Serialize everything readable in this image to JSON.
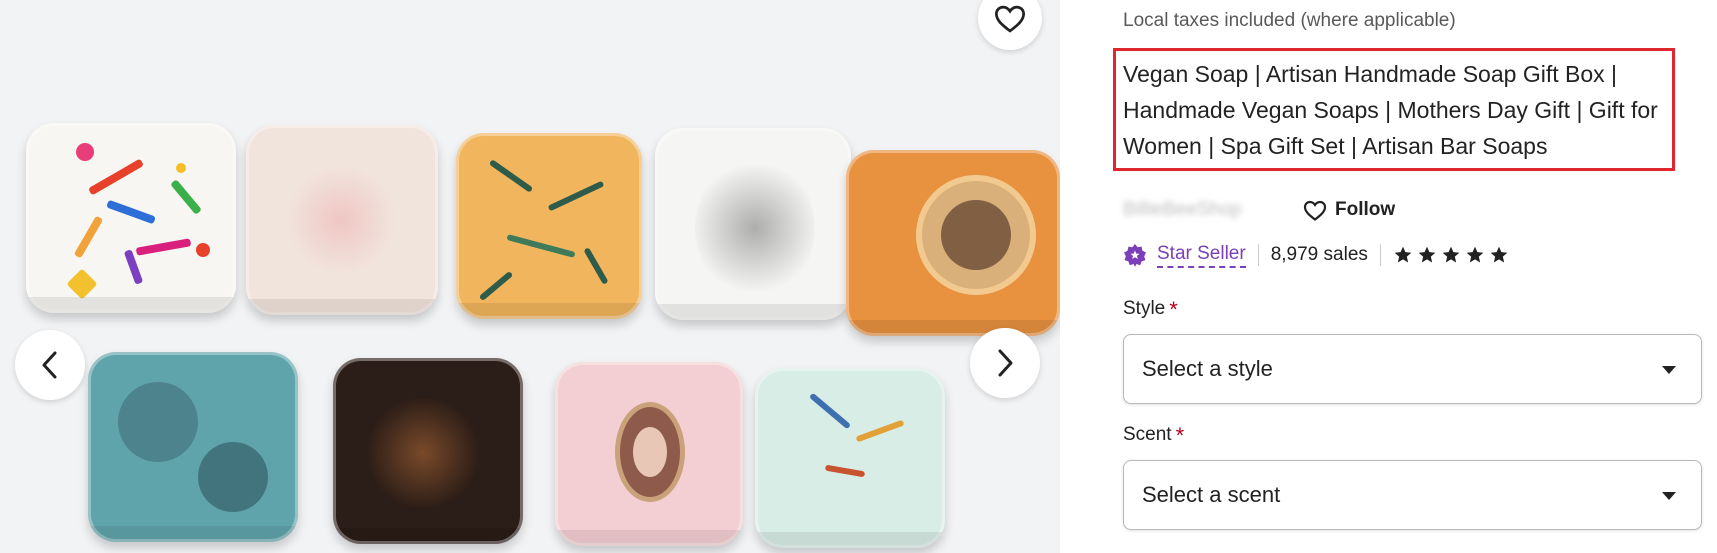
{
  "image": {
    "favorite_icon": "heart-outline-icon",
    "prev_icon": "chevron-left-icon",
    "next_icon": "chevron-right-icon"
  },
  "listing": {
    "tax_note": "Local taxes included (where applicable)",
    "title": "Vegan Soap | Artisan Handmade Soap Gift Box | Handmade Vegan Soaps | Mothers Day Gift | Gift for Women | Spa Gift Set | Artisan Bar Soaps"
  },
  "shop": {
    "name": "BillieBeeShop",
    "follow_label": "Follow",
    "star_seller_label": "Star Seller",
    "sales": "8,979 sales",
    "rating_stars": 5
  },
  "options": {
    "style_label": "Style",
    "style_placeholder": "Select a style",
    "scent_label": "Scent",
    "scent_placeholder": "Select a scent",
    "required_marker": "*"
  },
  "colors": {
    "highlight_border": "#e0262f",
    "star_seller": "#7b3fb7",
    "required": "#b3001b"
  }
}
